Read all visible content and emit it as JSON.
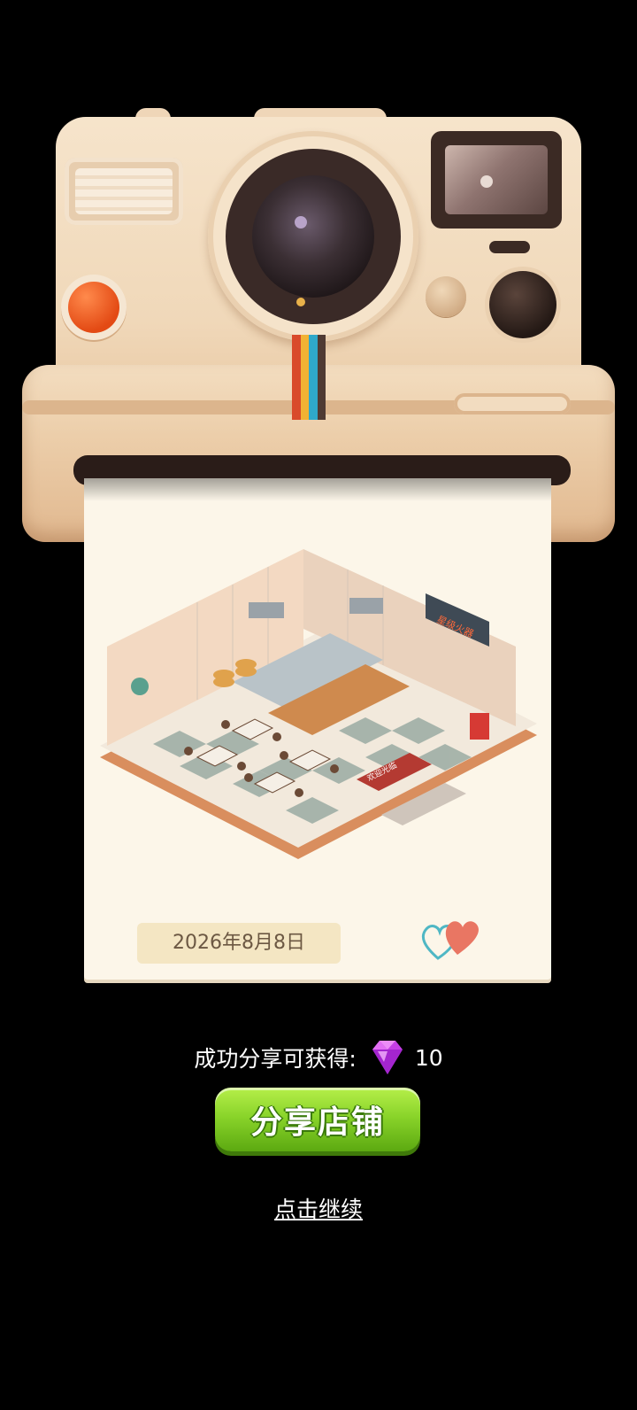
{
  "photo": {
    "date": "2026年8月8日",
    "shop_sign": "星级火器",
    "doormat_text": "欢迎光临"
  },
  "reward": {
    "text": "成功分享可获得:",
    "amount": "10",
    "icon": "gem-icon",
    "gem_color": "#c53ee6"
  },
  "share_button": {
    "label": "分享店铺",
    "color": "#8ad42a"
  },
  "continue_link": {
    "label": "点击继续"
  },
  "camera": {
    "icon": "camera-icon",
    "body_color": "#f0d8b9",
    "shutter_color": "#e34a14",
    "stripe_colors": [
      "#d94a2b",
      "#f2b233",
      "#2fa8c9",
      "#4f3a33"
    ]
  }
}
